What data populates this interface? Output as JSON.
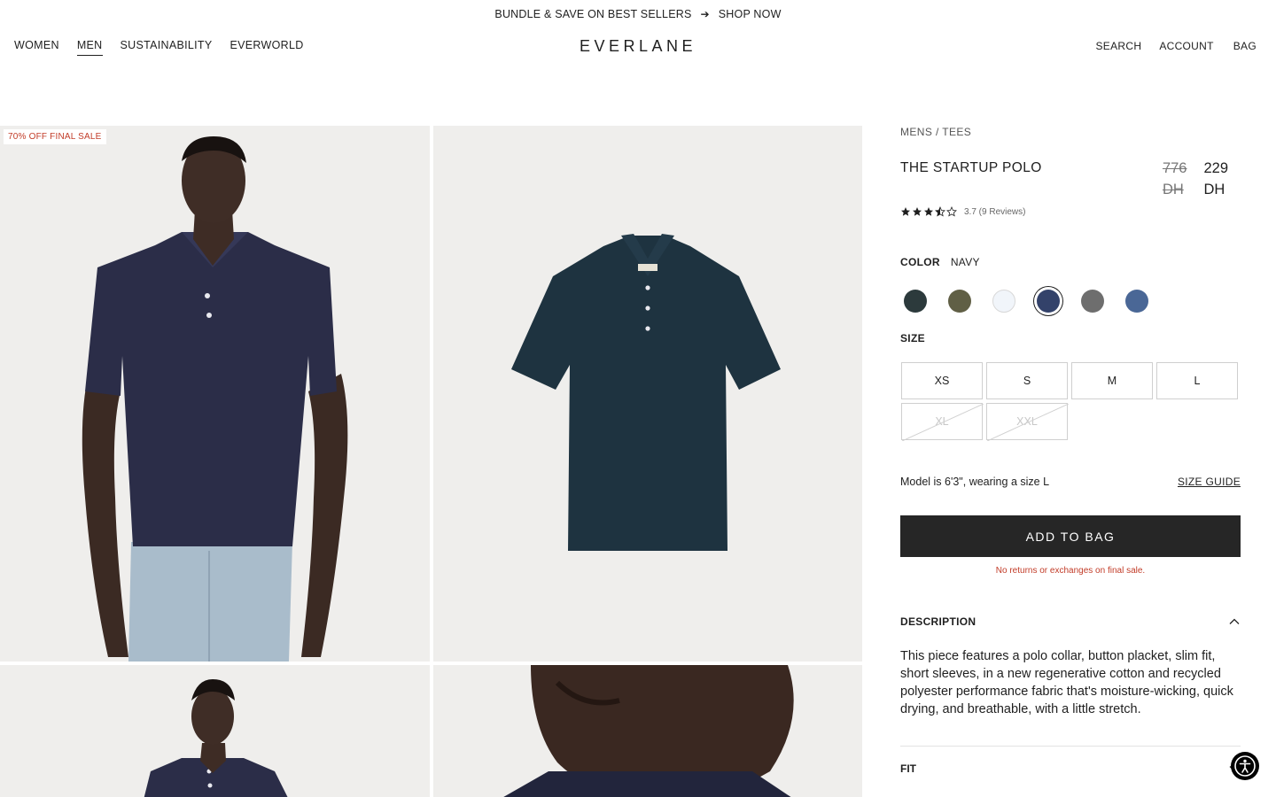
{
  "promo": {
    "text": "BUNDLE & SAVE ON BEST SELLERS",
    "cta": "SHOP NOW",
    "arrow_icon": "arrow-right-icon"
  },
  "nav": {
    "left": [
      "WOMEN",
      "MEN",
      "SUSTAINABILITY",
      "EVERWORLD"
    ],
    "active": "MEN",
    "logo": "EVERLANE",
    "right": [
      "SEARCH",
      "ACCOUNT",
      "BAG"
    ]
  },
  "gallery": {
    "badge": "70% OFF FINAL SALE",
    "images": [
      "model-front",
      "flat-lay-navy",
      "model-full",
      "model-closeup"
    ]
  },
  "product": {
    "breadcrumb": "MENS / TEES",
    "title": "THE STARTUP POLO",
    "price_old_amount": "776",
    "price_old_currency": "DH",
    "price_new_amount": "229",
    "price_new_currency": "DH",
    "rating_value": 3.7,
    "rating_text": "3.7 (9 Reviews)",
    "color_label": "COLOR",
    "color_value": "NAVY",
    "swatches": [
      {
        "name": "dark-green",
        "hex": "#2c3a3c"
      },
      {
        "name": "olive",
        "hex": "#605f45"
      },
      {
        "name": "white",
        "hex": "#f1f5fa"
      },
      {
        "name": "navy",
        "hex": "#33426a",
        "selected": true
      },
      {
        "name": "grey",
        "hex": "#6e6e6e"
      },
      {
        "name": "blue",
        "hex": "#4a6796"
      }
    ],
    "size_label": "SIZE",
    "sizes": [
      {
        "label": "XS",
        "available": true
      },
      {
        "label": "S",
        "available": true
      },
      {
        "label": "M",
        "available": true
      },
      {
        "label": "L",
        "available": true
      },
      {
        "label": "XL",
        "available": false
      },
      {
        "label": "XXL",
        "available": false
      }
    ],
    "model_note": "Model is 6'3\", wearing a size L",
    "size_guide": "SIZE GUIDE",
    "add_to_bag": "ADD TO BAG",
    "final_sale_notice": "No returns or exchanges on final sale.",
    "description_label": "DESCRIPTION",
    "description": "This piece features a polo collar, button placket, slim fit, short sleeves, in a new regenerative cotton and recycled polyester performance fabric that's moisture-wicking, quick drying, and breathable, with a little stretch.",
    "fit_label": "FIT"
  },
  "colors": {
    "text": "#1f1f1f",
    "sale_red": "#c23c28",
    "button_bg": "#262626",
    "image_bg": "#efeeec"
  }
}
